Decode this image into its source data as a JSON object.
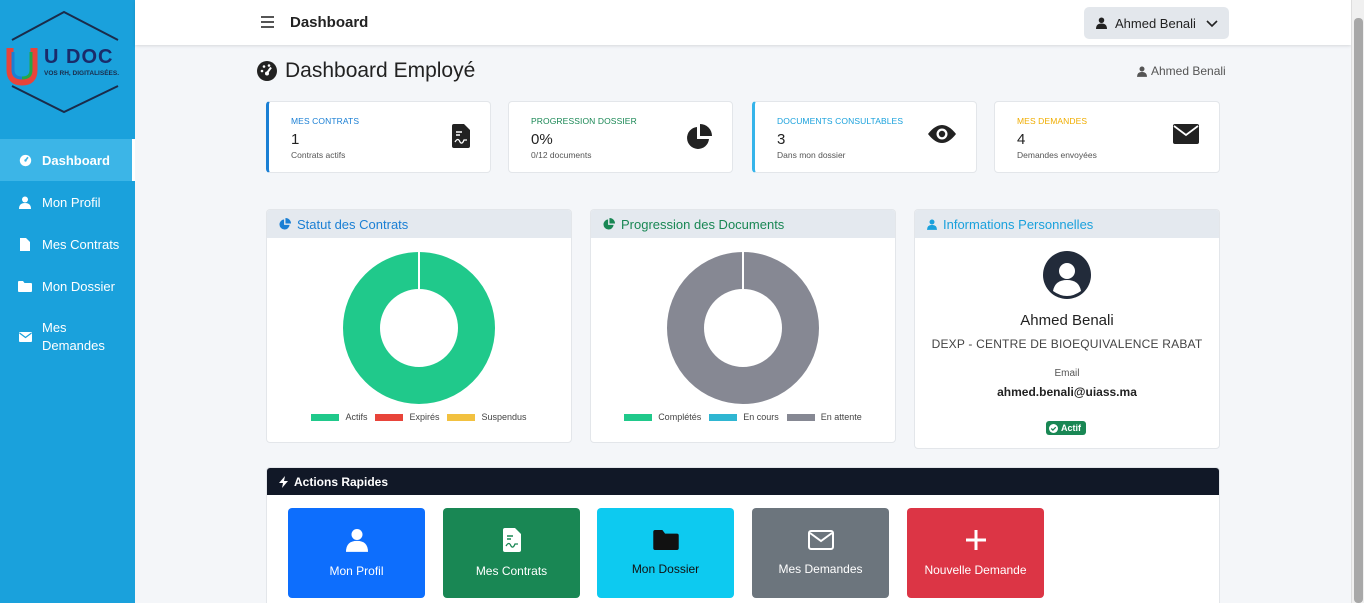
{
  "logo": {
    "brand": "U DOC",
    "tagline": "VOS RH, DIGITALISÉES."
  },
  "sidebar": {
    "items": [
      {
        "label": "Dashboard",
        "icon": "dashboard-icon"
      },
      {
        "label": "Mon Profil",
        "icon": "user-icon"
      },
      {
        "label": "Mes Contrats",
        "icon": "file-icon"
      },
      {
        "label": "Mon Dossier",
        "icon": "folder-icon"
      },
      {
        "label": "Mes Demandes",
        "icon": "envelope-icon"
      }
    ]
  },
  "topbar": {
    "title": "Dashboard",
    "user": "Ahmed Benali"
  },
  "page": {
    "title": "Dashboard Employé",
    "user": "Ahmed Benali"
  },
  "stats": [
    {
      "label": "MES CONTRATS",
      "value": "1",
      "sub": "Contrats actifs",
      "color": "#1a7fd4",
      "icon": "contract-icon"
    },
    {
      "label": "PROGRESSION DOSSIER",
      "value": "0%",
      "sub": "0/12 documents",
      "color": "#198754",
      "icon": "pie-chart-icon"
    },
    {
      "label": "DOCUMENTS CONSULTABLES",
      "value": "3",
      "sub": "Dans mon dossier",
      "color": "#1aa1dc",
      "icon": "eye-icon"
    },
    {
      "label": "MES DEMANDES",
      "value": "4",
      "sub": "Demandes envoyées",
      "color": "#f0ad00",
      "icon": "envelope-icon"
    }
  ],
  "panels": {
    "contracts": {
      "title": "Statut des Contrats",
      "legend": [
        "Actifs",
        "Expirés",
        "Suspendus"
      ],
      "colors": [
        "#20c98b",
        "#e8443a",
        "#f2c140"
      ]
    },
    "documents": {
      "title": "Progression des Documents",
      "legend": [
        "Complétés",
        "En cours",
        "En attente"
      ],
      "colors": [
        "#20c98b",
        "#2fb6d2",
        "#868893"
      ]
    },
    "info": {
      "title": "Informations Personnelles",
      "name": "Ahmed Benali",
      "org": "DEXP - CENTRE DE BIOEQUIVALENCE RABAT",
      "email_label": "Email",
      "email": "ahmed.benali@uiass.ma",
      "status": "Actif"
    }
  },
  "chart_data": [
    {
      "type": "pie",
      "title": "Statut des Contrats",
      "categories": [
        "Actifs",
        "Expirés",
        "Suspendus"
      ],
      "values": [
        1,
        0,
        0
      ]
    },
    {
      "type": "pie",
      "title": "Progression des Documents",
      "categories": [
        "Complétés",
        "En cours",
        "En attente"
      ],
      "values": [
        0,
        0,
        12
      ]
    }
  ],
  "quick_actions": {
    "title": "Actions Rapides",
    "items": [
      {
        "label": "Mon Profil",
        "color": "#0d6efd"
      },
      {
        "label": "Mes Contrats",
        "color": "#198754"
      },
      {
        "label": "Mon Dossier",
        "color": "#0dcaf0"
      },
      {
        "label": "Mes Demandes",
        "color": "#6c757d"
      },
      {
        "label": "Nouvelle Demande",
        "color": "#dc3545"
      }
    ]
  }
}
